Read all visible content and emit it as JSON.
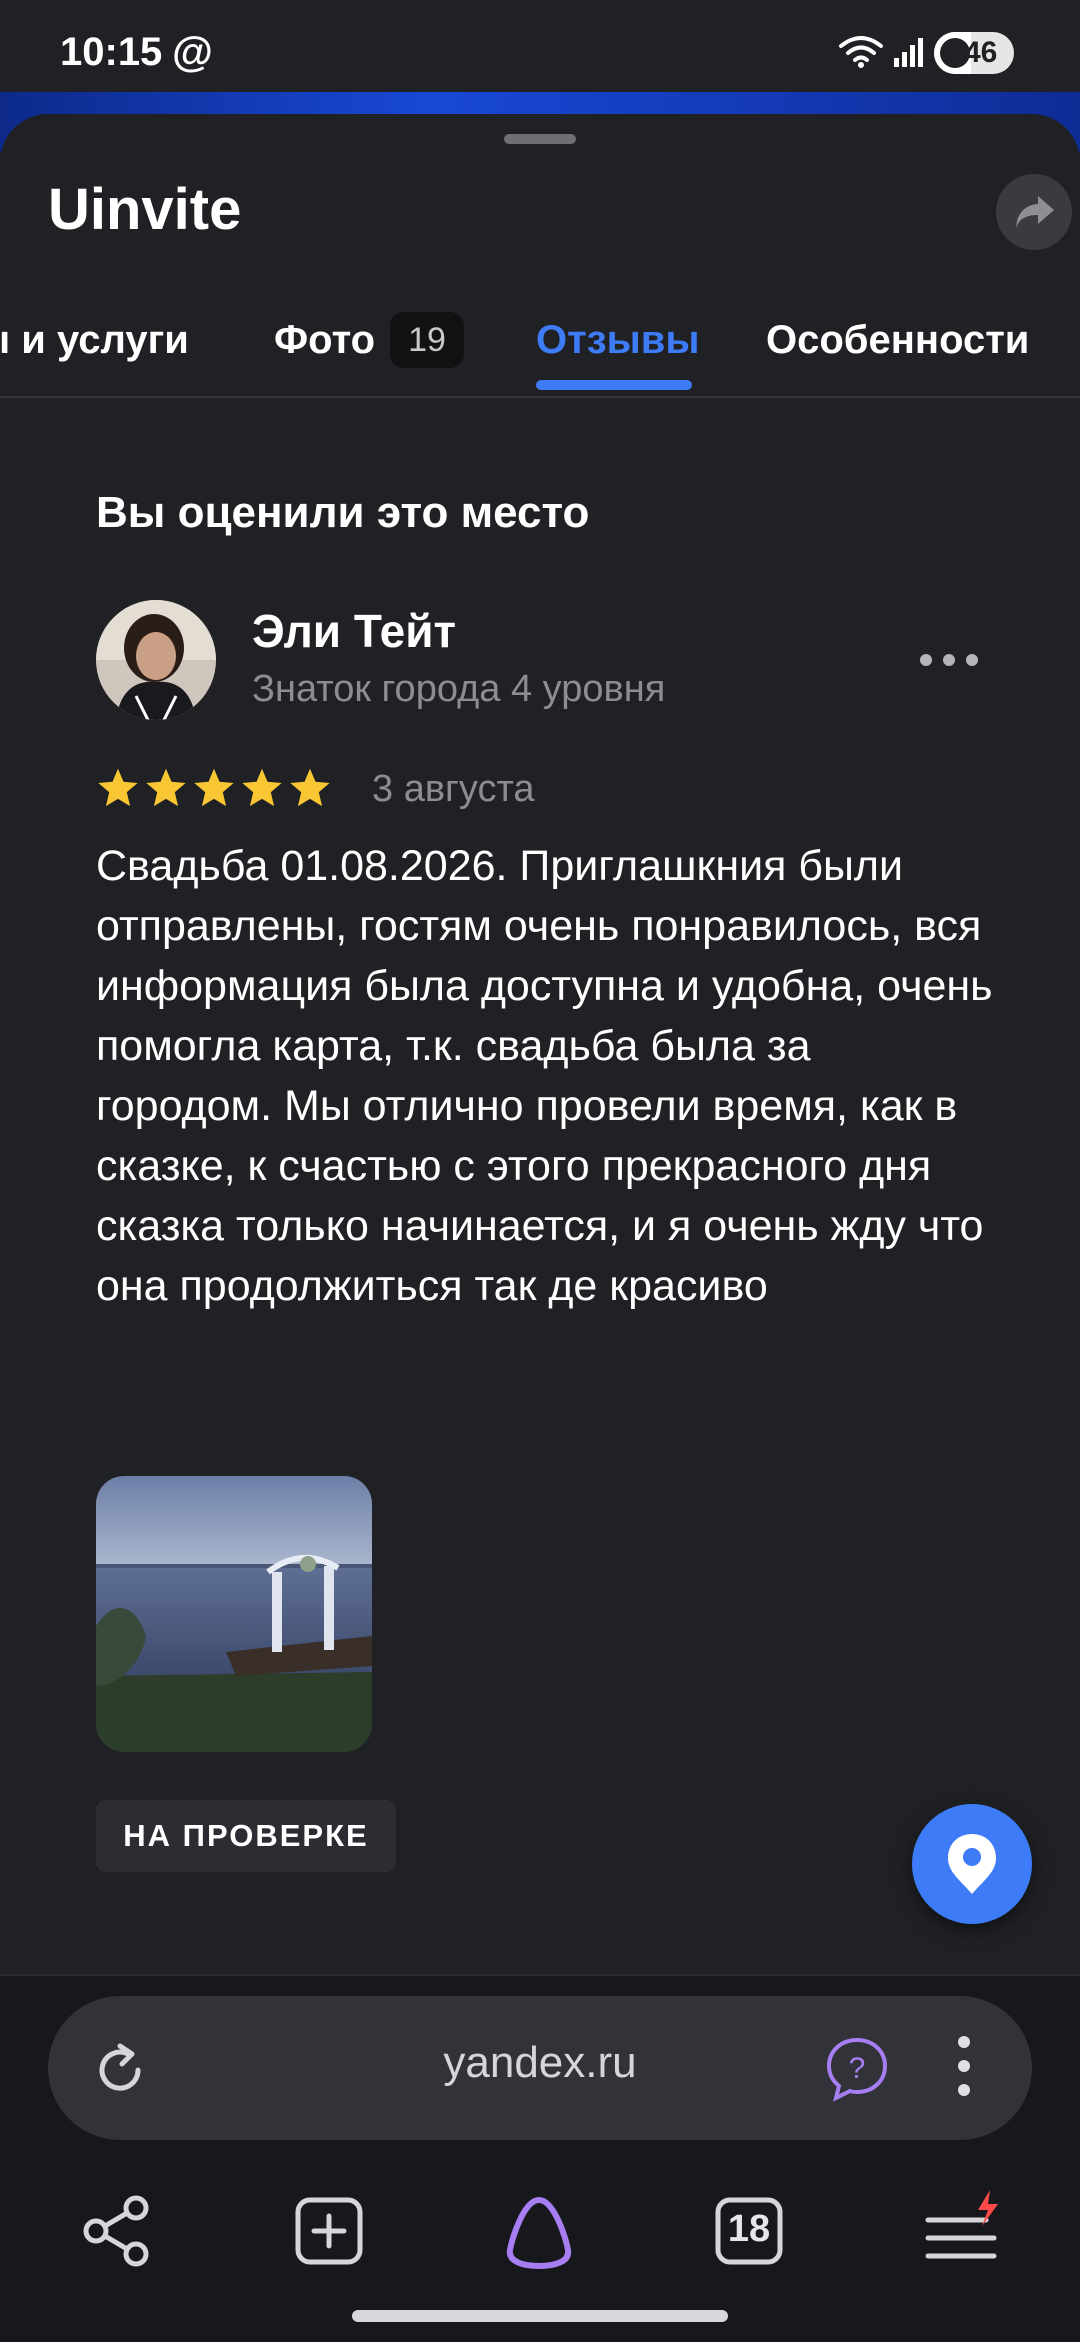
{
  "status_bar": {
    "time": "10:15",
    "at_symbol": "@",
    "battery_level": "46",
    "battery_percent": 46
  },
  "place": {
    "title": "Uinvite"
  },
  "tabs": [
    {
      "label": "ы и услуги"
    },
    {
      "label": "Фото",
      "count": "19"
    },
    {
      "label": "Отзывы",
      "active": true
    },
    {
      "label": "Особенности"
    }
  ],
  "review": {
    "section_title": "Вы оценили это место",
    "author_name": "Эли Тейт",
    "author_level": "Знаток города 4 уровня",
    "rating": 5,
    "rating_max": 5,
    "date": "3 августа",
    "text": "Свадьба 01.08.2026. Приглашкния были отправлены, гостям очень понравилось, вся информация была доступна и удобна, очень помогла карта, т.к. свадьба была за городом. Мы отлично провели время, как в сказке, к счастью с этого прекрасного дня сказка только начинается, и я очень жду что она продолжиться так де красиво",
    "status_badge": "НА ПРОВЕРКЕ"
  },
  "browser": {
    "url": "yandex.ru",
    "tab_count": "18"
  },
  "colors": {
    "background": "#202125",
    "accent": "#3d7bf7",
    "star": "#f9c634",
    "alice": "#a77ef2"
  },
  "icons": {
    "share": "share-arrow-icon",
    "more": "more-horizontal-icon",
    "location": "location-pin-icon",
    "reload": "reload-icon",
    "help": "help-bubble-icon",
    "nav_share": "share-nodes-icon",
    "new_tab": "plus-square-icon",
    "alice": "alice-icon",
    "menu": "hamburger-menu-icon"
  }
}
